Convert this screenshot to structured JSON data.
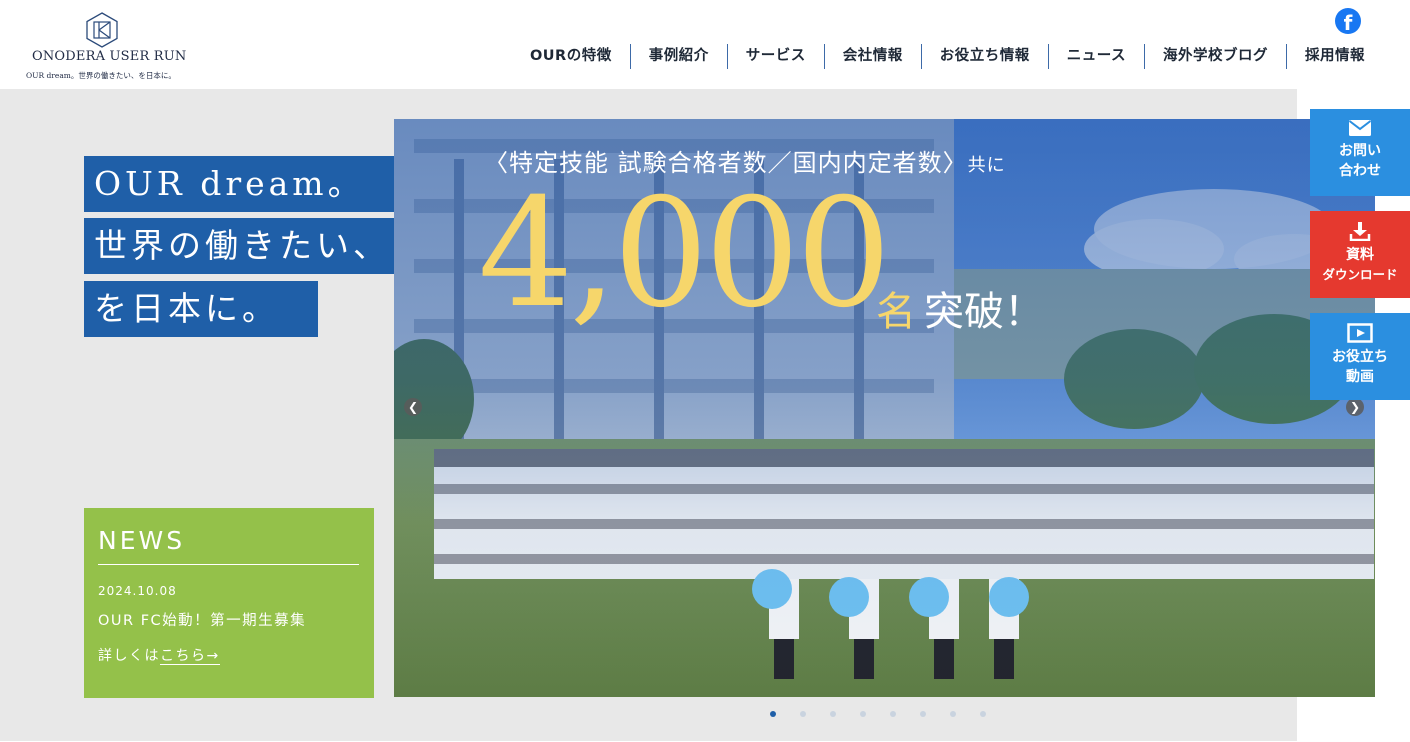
{
  "logo": {
    "name": "ONODERA USER RUN",
    "tagline": "OUR dream。世界の働きたい、を日本に。"
  },
  "social": {
    "icon": "facebook-icon",
    "glyph": "f"
  },
  "nav": {
    "items": [
      "OURの特徴",
      "事例紹介",
      "サービス",
      "会社情報",
      "お役立ち情報",
      "ニュース",
      "海外学校ブログ",
      "採用情報"
    ]
  },
  "hero": {
    "tagline": [
      "OUR dream。",
      "世界の働きたい、",
      "を日本に。"
    ],
    "slide": {
      "headline": "〈特定技能 試験合格者数／国内内定者数〉",
      "headline_suffix": "共に",
      "number": "4,000",
      "unit": "名",
      "suffix": "突破！"
    },
    "dots_count": 8,
    "active_dot": 0,
    "prev_glyph": "❮",
    "next_glyph": "❯"
  },
  "news": {
    "title": "NEWS",
    "date": "2024.10.08",
    "text": "OUR FC始動！第一期生募集",
    "more_prefix": "詳しくは",
    "more_link": "こちら→"
  },
  "side_buttons": {
    "contact": {
      "line1": "お問い",
      "line2": "合わせ",
      "icon": "mail-icon"
    },
    "download": {
      "line1": "資料",
      "line2": "ダウンロード",
      "icon": "download-icon"
    },
    "video": {
      "line1": "お役立ち",
      "line2": "動画",
      "icon": "play-icon"
    }
  },
  "colors": {
    "brand_blue": "#1f5fa8",
    "news_green": "#94c14a",
    "accent_yellow": "#f6d66b",
    "download_red": "#e5392f",
    "side_blue": "#2b8fe0"
  }
}
